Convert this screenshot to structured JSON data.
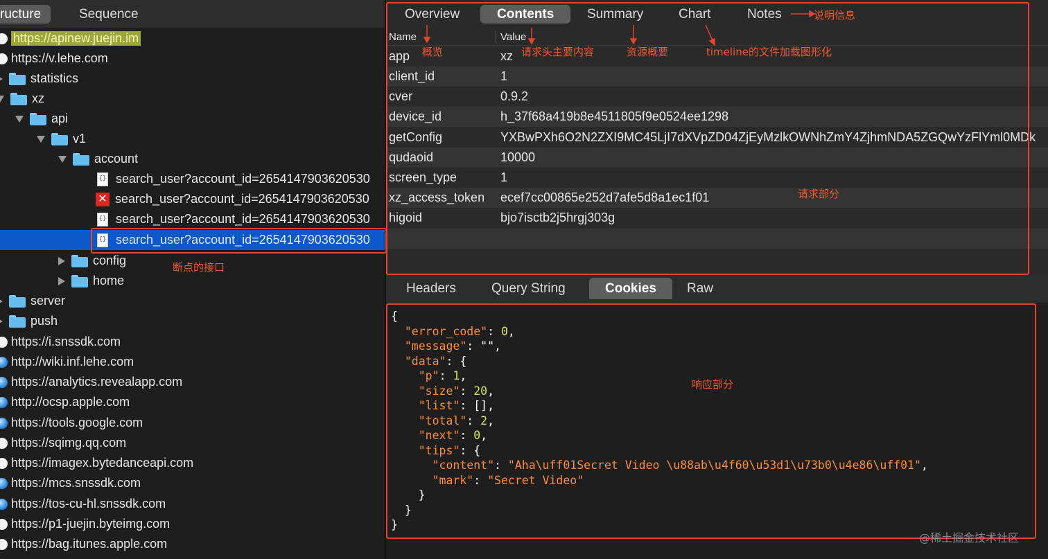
{
  "left_tabs": [
    "ructure",
    "Sequence"
  ],
  "tree": [
    {
      "label": "https://apinew.juejin.im",
      "icon": "globe-white",
      "highlight": true
    },
    {
      "label": "https://v.lehe.com",
      "icon": "globe-white"
    },
    {
      "label": "statistics",
      "icon": "folder"
    },
    {
      "label": "xz",
      "icon": "folder"
    },
    {
      "label": "api",
      "icon": "folder"
    },
    {
      "label": "v1",
      "icon": "folder"
    },
    {
      "label": "account",
      "icon": "folder"
    },
    {
      "label": "search_user?account_id=2654147903620530",
      "icon": "json-file"
    },
    {
      "label": "search_user?account_id=2654147903620530",
      "icon": "error"
    },
    {
      "label": "search_user?account_id=2654147903620530",
      "icon": "json-file"
    },
    {
      "label": "search_user?account_id=2654147903620530",
      "icon": "json-file",
      "selected": true
    },
    {
      "label": "config",
      "icon": "folder"
    },
    {
      "label": "home",
      "icon": "folder"
    },
    {
      "label": "server",
      "icon": "folder"
    },
    {
      "label": "push",
      "icon": "folder"
    },
    {
      "label": "https://i.snssdk.com",
      "icon": "globe-white"
    },
    {
      "label": "http://wiki.inf.lehe.com",
      "icon": "globe-blue"
    },
    {
      "label": "https://analytics.revealapp.com",
      "icon": "globe-blue"
    },
    {
      "label": "http://ocsp.apple.com",
      "icon": "globe-blue"
    },
    {
      "label": "https://tools.google.com",
      "icon": "globe-blue"
    },
    {
      "label": "https://sqimg.qq.com",
      "icon": "globe-white"
    },
    {
      "label": "https://imagex.bytedanceapi.com",
      "icon": "globe-white"
    },
    {
      "label": "https://mcs.snssdk.com",
      "icon": "globe-blue"
    },
    {
      "label": "https://tos-cu-hl.snssdk.com",
      "icon": "globe-blue"
    },
    {
      "label": "https://p1-juejin.byteimg.com",
      "icon": "globe-white"
    },
    {
      "label": "https://bag.itunes.apple.com",
      "icon": "globe-white"
    }
  ],
  "top_tabs": [
    "Overview",
    "Contents",
    "Summary",
    "Chart",
    "Notes"
  ],
  "columns": {
    "name": "Name",
    "value": "Value"
  },
  "params": [
    {
      "k": "app",
      "v": "xz"
    },
    {
      "k": "client_id",
      "v": "1"
    },
    {
      "k": "cver",
      "v": "0.9.2"
    },
    {
      "k": "device_id",
      "v": "h_37f68a419b8e4511805f9e0524ee1298"
    },
    {
      "k": "getConfig",
      "v": "YXBwPXh6O2N2ZXI9MC45LjI7dXVpZD04ZjEyMzlkOWNhZmY4ZjhmNDA5ZGQwYzFlYml0MDk"
    },
    {
      "k": "qudaoid",
      "v": "10000"
    },
    {
      "k": "screen_type",
      "v": "1"
    },
    {
      "k": "xz_access_token",
      "v": "ecef7cc00865e252d7afe5d8a1ec1f01"
    },
    {
      "k": "higoid",
      "v": "bjo7isctb2j5hrgj303g"
    }
  ],
  "bottom_tabs": [
    "Headers",
    "Query String",
    "Cookies",
    "Raw"
  ],
  "response_json": {
    "error_code": "0",
    "message": "\"\"",
    "data_p": "1",
    "data_size": "20",
    "data_list": "[]",
    "data_total": "2",
    "data_next": "0",
    "tips_content": "\"Aha\\uff01Secret Video \\u88ab\\u4f60\\u53d1\\u73b0\\u4e86\\uff01\"",
    "tips_mark": "\"Secret Video\""
  },
  "annotations": {
    "notes": "说明信息",
    "overview": "概览",
    "contents": "请求头主要内容",
    "summary": "资源概要",
    "chart": "timeline的文件加载图形化",
    "request": "请求部分",
    "breakpoint": "断点的接口",
    "response": "响应部分"
  },
  "watermark": "@稀土掘金技术社区",
  "colors": {
    "annotation": "#e8432c",
    "selection": "#0a58ca",
    "json_key": "#ff8c3a",
    "json_number": "#d7e36b"
  }
}
